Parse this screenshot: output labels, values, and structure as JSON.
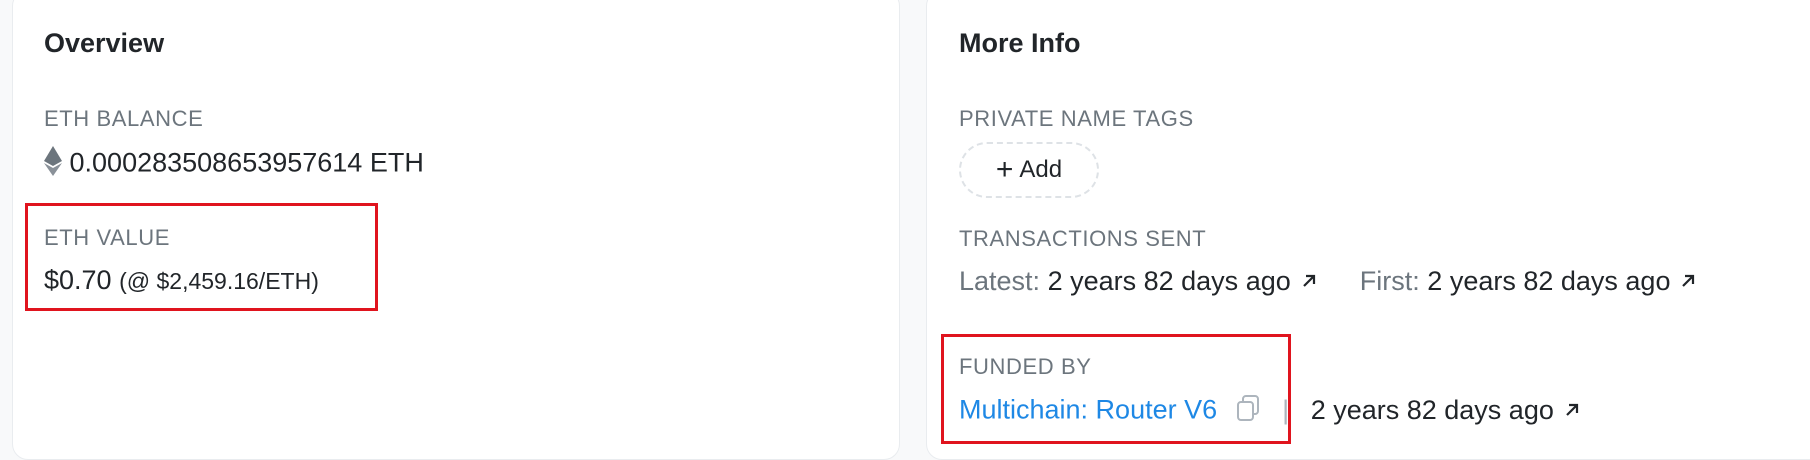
{
  "overview": {
    "title": "Overview",
    "eth_balance_label": "ETH BALANCE",
    "eth_balance_value": "0.000283508653957614 ETH",
    "eth_value_label": "ETH VALUE",
    "eth_value_usd": "$0.70",
    "eth_value_rate": "(@ $2,459.16/ETH)"
  },
  "more_info": {
    "title": "More Info",
    "private_name_tags_label": "PRIVATE NAME TAGS",
    "add_label": "Add",
    "transactions_sent_label": "TRANSACTIONS SENT",
    "latest_label": "Latest:",
    "latest_value": "2 years 82 days ago",
    "first_label": "First:",
    "first_value": "2 years 82 days ago",
    "funded_by_label": "FUNDED BY",
    "funded_by_name": "Multichain: Router V6",
    "funded_separator": "|",
    "funded_time": "2 years 82 days ago"
  },
  "icons": {
    "eth": "ethereum-icon",
    "plus": "plus-icon",
    "arrow": "arrow-up-right-icon",
    "copy": "copy-icon"
  },
  "colors": {
    "link": "#1e88e5",
    "highlight": "#e0141e",
    "muted": "#6c757d"
  }
}
